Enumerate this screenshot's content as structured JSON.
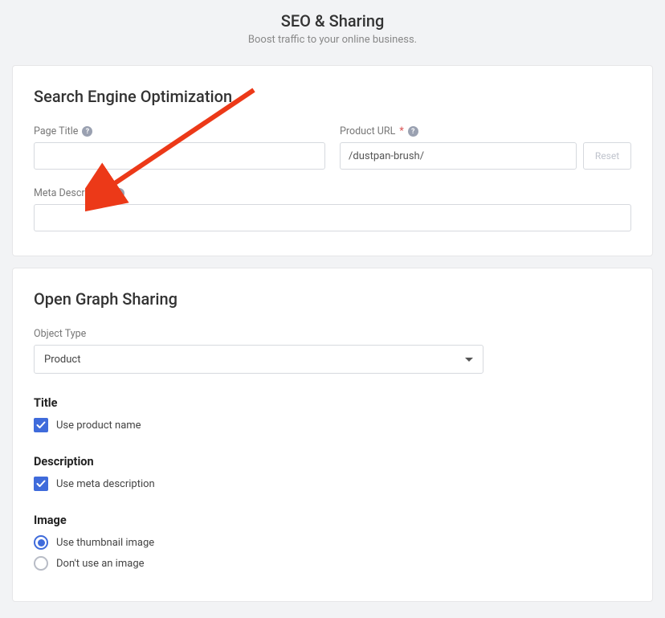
{
  "header": {
    "title": "SEO & Sharing",
    "subtitle": "Boost traffic to your online business."
  },
  "seo": {
    "title": "Search Engine Optimization",
    "page_title_label": "Page Title",
    "product_url_label": "Product URL",
    "product_url_value": "/dustpan-brush/",
    "reset_label": "Reset",
    "meta_desc_label": "Meta Description"
  },
  "og": {
    "title": "Open Graph Sharing",
    "object_type_label": "Object Type",
    "object_type_value": "Product",
    "title_h": "Title",
    "title_chk": "Use product name",
    "desc_h": "Description",
    "desc_chk": "Use meta description",
    "image_h": "Image",
    "image_r1": "Use thumbnail image",
    "image_r2": "Don't use an image"
  }
}
